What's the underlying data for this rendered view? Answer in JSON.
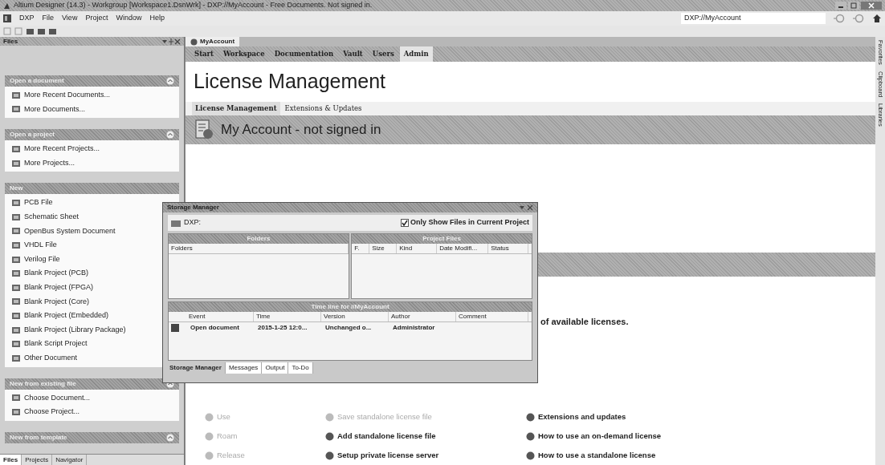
{
  "window": {
    "title": "Altium Designer (14.3) - Workgroup [Workspace1.DsnWrk] - DXP://MyAccount - Free Documents. Not signed in."
  },
  "menu": [
    "DXP",
    "File",
    "View",
    "Project",
    "Window",
    "Help"
  ],
  "address": {
    "value": "DXP://MyAccount"
  },
  "files_panel": {
    "title": "Files",
    "sections": [
      {
        "title": "Open a document",
        "chevron": true,
        "items": [
          "More Recent Documents...",
          "More Documents..."
        ]
      },
      {
        "title": "Open a project",
        "chevron": true,
        "items": [
          "More Recent Projects...",
          "More Projects..."
        ]
      },
      {
        "title": "New",
        "chevron": false,
        "items": [
          "PCB File",
          "Schematic Sheet",
          "OpenBus System Document",
          "VHDL File",
          "Verilog File",
          "Blank Project (PCB)",
          "Blank Project (FPGA)",
          "Blank Project (Core)",
          "Blank Project (Embedded)",
          "Blank Project (Library Package)",
          "Blank Script Project",
          "Other Document"
        ]
      },
      {
        "title": "New from existing file",
        "chevron": true,
        "items": [
          "Choose Document...",
          "Choose Project..."
        ]
      },
      {
        "title": "New from template",
        "chevron": true
      }
    ],
    "tabs": [
      {
        "label": "Files",
        "selected": true
      },
      {
        "label": "Projects",
        "selected": false
      },
      {
        "label": "Navigator",
        "selected": false
      }
    ]
  },
  "document": {
    "tab": "MyAccount",
    "nav": [
      {
        "label": "Start",
        "selected": false
      },
      {
        "label": "Workspace",
        "selected": false
      },
      {
        "label": "Documentation",
        "selected": false
      },
      {
        "label": "Vault",
        "selected": false
      },
      {
        "label": "Users",
        "selected": false
      },
      {
        "label": "Admin",
        "selected": true
      }
    ],
    "heading": "License Management",
    "subtabs": [
      {
        "label": "License Management",
        "selected": true
      },
      {
        "label": "Extensions & Updates",
        "selected": false
      }
    ],
    "account_title": "My Account - not signed in",
    "partial_text": "of available licenses.",
    "actions": [
      {
        "label": "Use",
        "disabled": true
      },
      {
        "label": "Roam",
        "disabled": true
      },
      {
        "label": "Release",
        "disabled": true
      },
      {
        "label": "Save standalone license file",
        "disabled": true
      },
      {
        "label": "Add standalone license file",
        "disabled": false
      },
      {
        "label": "Setup private license server",
        "disabled": false
      },
      {
        "label": "Extensions and updates",
        "disabled": false
      },
      {
        "label": "How to use an on-demand license",
        "disabled": false
      },
      {
        "label": "How to use a standalone license",
        "disabled": false
      }
    ]
  },
  "side_tabs": [
    "Favorites",
    "Clipboard",
    "Libraries"
  ],
  "storage_manager": {
    "title": "Storage Manager",
    "path": "DXP:",
    "only_current": {
      "label": "Only Show Files in Current Project",
      "checked": true
    },
    "folders": {
      "title": "Folders",
      "columns": [
        "Folders"
      ]
    },
    "project_files": {
      "title": "Project Files",
      "columns": [
        "F.",
        "Size",
        "Kind",
        "Date Modifi...",
        "Status"
      ]
    },
    "timeline": {
      "title": "Time line for //MyAccount",
      "columns": [
        "Event",
        "Time",
        "Version",
        "Author",
        "Comment"
      ],
      "rows": [
        [
          "Open document",
          "2015-1-25 12:0...",
          "Unchanged o...",
          "Administrator"
        ]
      ]
    },
    "tabs": [
      {
        "label": "Storage Manager",
        "selected": true
      },
      {
        "label": "Messages",
        "selected": false
      },
      {
        "label": "Output",
        "selected": false
      },
      {
        "label": "To-Do",
        "selected": false
      }
    ]
  }
}
